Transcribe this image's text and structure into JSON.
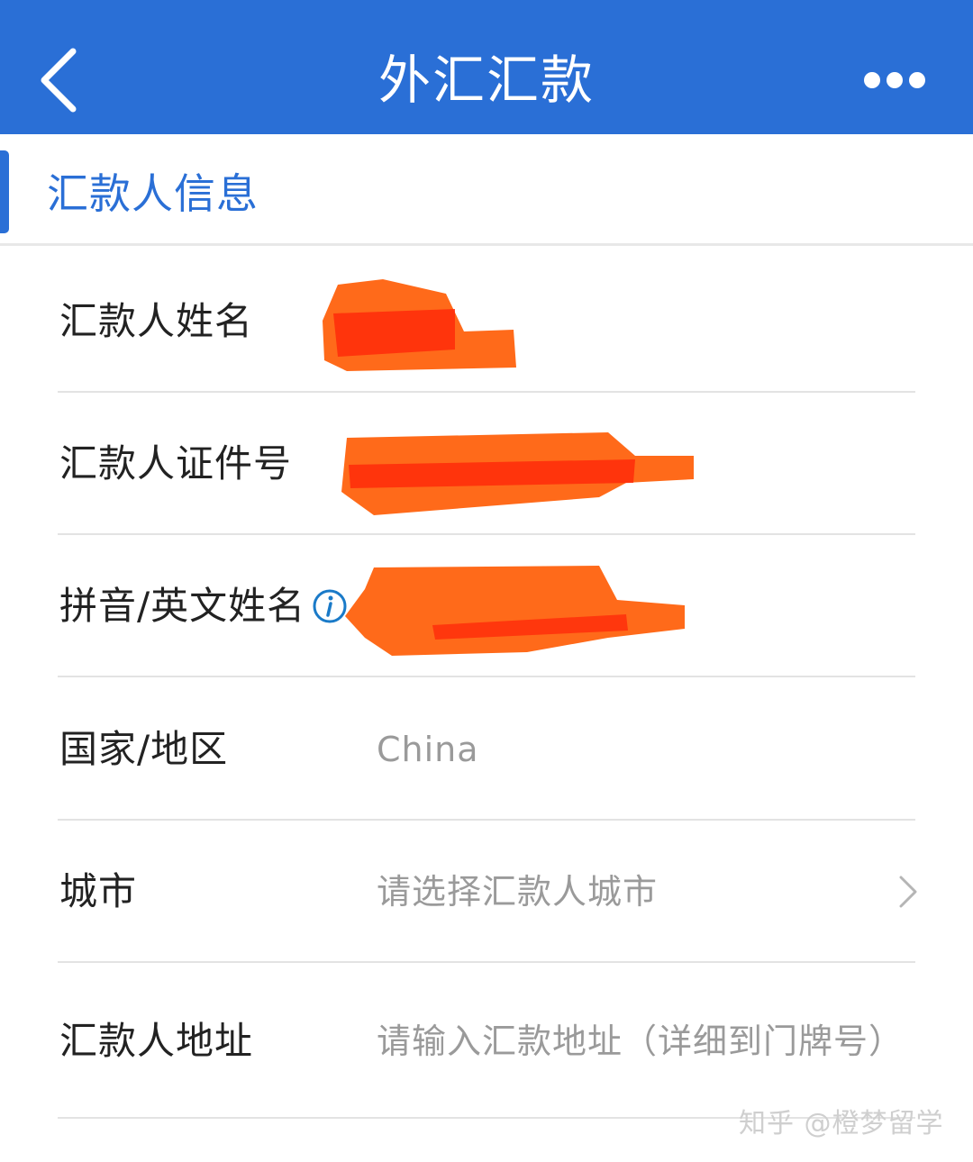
{
  "header": {
    "title": "外汇汇款",
    "back_icon": "chevron-left-icon",
    "more_icon": "more-dots-icon",
    "color": "#2a6fd6"
  },
  "section": {
    "title": "汇款人信息"
  },
  "form": {
    "name": {
      "label": "汇款人姓名"
    },
    "id_number": {
      "label": "汇款人证件号"
    },
    "pinyin_name": {
      "label": "拼音/英文姓名"
    },
    "country": {
      "label": "国家/地区",
      "value": "China"
    },
    "city": {
      "label": "城市",
      "placeholder": "请选择汇款人城市"
    },
    "address": {
      "label": "汇款人地址",
      "placeholder": "请输入汇款地址（详细到门牌号）"
    }
  },
  "watermark": "知乎 @橙梦留学",
  "colors": {
    "accent": "#2a6fd6",
    "redaction": "#ff5a1f",
    "placeholder": "#9a9a9a"
  }
}
